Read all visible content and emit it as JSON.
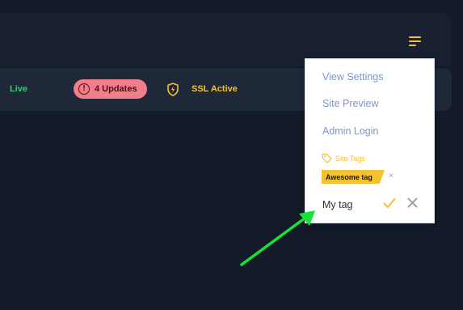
{
  "header": {
    "menu_icon": "hamburger-menu-icon",
    "accent_color": "#f2c233"
  },
  "status": {
    "live_label": "Live",
    "live_color": "#25d366",
    "updates_label": "4 Updates",
    "updates_icon": "alert-circle-icon",
    "updates_bg": "#f27e8c",
    "ssl_label": "SSL Active",
    "ssl_icon": "shield-bolt-icon"
  },
  "dropdown": {
    "items": [
      {
        "label": "View Settings"
      },
      {
        "label": "Site Preview"
      },
      {
        "label": "Admin Login"
      }
    ],
    "tags_heading": "Site Tags",
    "tags_icon": "tag-icon",
    "tags": [
      {
        "label": "Awesome tag",
        "remove": "×"
      }
    ],
    "new_tag_value": "My tag",
    "confirm_icon": "check-icon",
    "cancel_icon": "close-icon"
  },
  "annotation": {
    "arrow_icon": "green-arrow-icon",
    "arrow_color": "#16e23a"
  }
}
